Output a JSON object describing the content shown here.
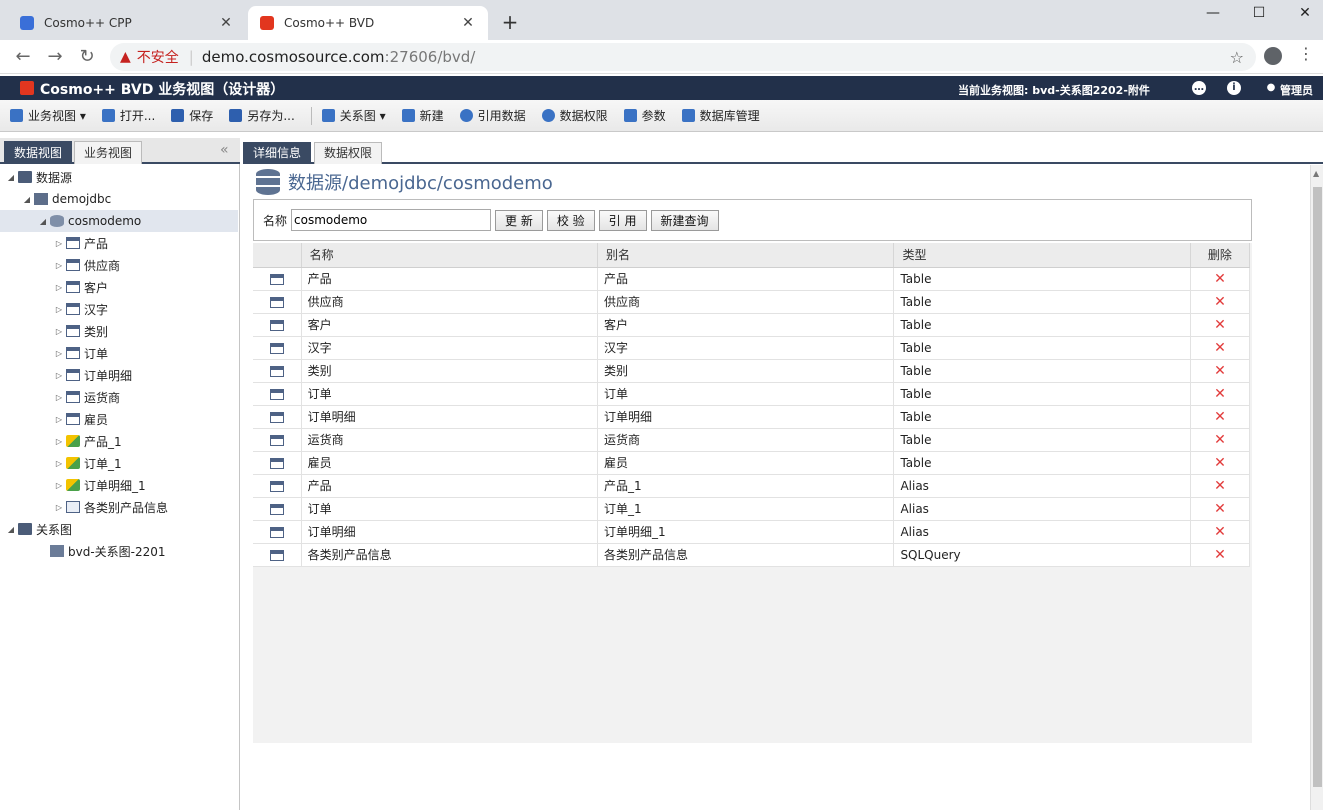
{
  "browser": {
    "tabs": [
      {
        "title": "Cosmo++ CPP",
        "active": false
      },
      {
        "title": "Cosmo++ BVD",
        "active": true
      }
    ],
    "new_tab": "+",
    "address": {
      "insecure_label": "不安全",
      "host": "demo.cosmosource.com",
      "path": ":27606/bvd/"
    },
    "window_controls": [
      "—",
      "☐",
      "✕"
    ]
  },
  "app": {
    "title": "Cosmo++ BVD 业务视图（设计器）",
    "current_view": "当前业务视图: bvd-关系图2202-附件",
    "user": "管理员"
  },
  "toolbar": {
    "items": [
      {
        "label": "业务视图 ▾",
        "icon": "business-view-icon",
        "color": "#3a72c4"
      },
      {
        "label": "打开...",
        "icon": "open-folder-icon",
        "color": "#3a72c4"
      },
      {
        "label": "保存",
        "icon": "save-icon",
        "color": "#2e5fae"
      },
      {
        "label": "另存为...",
        "icon": "save-as-icon",
        "color": "#2e5fae"
      },
      {
        "label": "关系图 ▾",
        "icon": "diagram-icon",
        "color": "#3a72c4"
      },
      {
        "label": "新建",
        "icon": "new-icon",
        "color": "#3a72c4"
      },
      {
        "label": "引用数据",
        "icon": "reference-data-icon",
        "color": "#3a72c4"
      },
      {
        "label": "数据权限",
        "icon": "data-permission-icon",
        "color": "#3a72c4"
      },
      {
        "label": "参数",
        "icon": "parameter-icon",
        "color": "#3a72c4"
      },
      {
        "label": "数据库管理",
        "icon": "database-manage-icon",
        "color": "#3a72c4"
      }
    ]
  },
  "left_panel": {
    "tabs": [
      "数据视图",
      "业务视图"
    ],
    "tree": [
      {
        "label": "数据源",
        "level": 0,
        "arrow": "◢",
        "icon": "folder"
      },
      {
        "label": "demojdbc",
        "level": 1,
        "arrow": "◢",
        "icon": "server"
      },
      {
        "label": "cosmodemo",
        "level": 2,
        "arrow": "◢",
        "icon": "db",
        "selected": true
      },
      {
        "label": "产品",
        "level": 3,
        "arrow": "▷",
        "icon": "table"
      },
      {
        "label": "供应商",
        "level": 3,
        "arrow": "▷",
        "icon": "table"
      },
      {
        "label": "客户",
        "level": 3,
        "arrow": "▷",
        "icon": "table"
      },
      {
        "label": "汉字",
        "level": 3,
        "arrow": "▷",
        "icon": "table"
      },
      {
        "label": "类别",
        "level": 3,
        "arrow": "▷",
        "icon": "table"
      },
      {
        "label": "订单",
        "level": 3,
        "arrow": "▷",
        "icon": "table"
      },
      {
        "label": "订单明细",
        "level": 3,
        "arrow": "▷",
        "icon": "table"
      },
      {
        "label": "运货商",
        "level": 3,
        "arrow": "▷",
        "icon": "table"
      },
      {
        "label": "雇员",
        "level": 3,
        "arrow": "▷",
        "icon": "table"
      },
      {
        "label": "产品_1",
        "level": 3,
        "arrow": "▷",
        "icon": "alias"
      },
      {
        "label": "订单_1",
        "level": 3,
        "arrow": "▷",
        "icon": "alias"
      },
      {
        "label": "订单明细_1",
        "level": 3,
        "arrow": "▷",
        "icon": "alias"
      },
      {
        "label": "各类别产品信息",
        "level": 3,
        "arrow": "▷",
        "icon": "sql"
      },
      {
        "label": "关系图",
        "level": 0,
        "arrow": "◢",
        "icon": "folder"
      },
      {
        "label": "bvd-关系图-2201",
        "level": 2,
        "arrow": "",
        "icon": "rel"
      }
    ]
  },
  "main": {
    "tabs": [
      "详细信息",
      "数据权限"
    ],
    "title": "数据源/demojdbc/cosmodemo",
    "form": {
      "name_label": "名称",
      "name_value": "cosmodemo",
      "buttons": [
        "更 新",
        "校 验",
        "引 用",
        "新建查询"
      ]
    },
    "grid": {
      "columns": [
        "",
        "名称",
        "别名",
        "类型",
        "删除"
      ],
      "rows": [
        {
          "name": "产品",
          "alias": "产品",
          "type": "Table"
        },
        {
          "name": "供应商",
          "alias": "供应商",
          "type": "Table"
        },
        {
          "name": "客户",
          "alias": "客户",
          "type": "Table"
        },
        {
          "name": "汉字",
          "alias": "汉字",
          "type": "Table"
        },
        {
          "name": "类别",
          "alias": "类别",
          "type": "Table"
        },
        {
          "name": "订单",
          "alias": "订单",
          "type": "Table"
        },
        {
          "name": "订单明细",
          "alias": "订单明细",
          "type": "Table"
        },
        {
          "name": "运货商",
          "alias": "运货商",
          "type": "Table"
        },
        {
          "name": "雇员",
          "alias": "雇员",
          "type": "Table"
        },
        {
          "name": "产品",
          "alias": "产品_1",
          "type": "Alias"
        },
        {
          "name": "订单",
          "alias": "订单_1",
          "type": "Alias"
        },
        {
          "name": "订单明细",
          "alias": "订单明细_1",
          "type": "Alias"
        },
        {
          "name": "各类别产品信息",
          "alias": "各类别产品信息",
          "type": "SQLQuery"
        }
      ],
      "delete_glyph": "✕"
    }
  },
  "colors": {
    "header_bg": "#22304a",
    "tab_active": "#3a4a63",
    "title_text": "#4a6791",
    "delete": "#e23b3b"
  }
}
